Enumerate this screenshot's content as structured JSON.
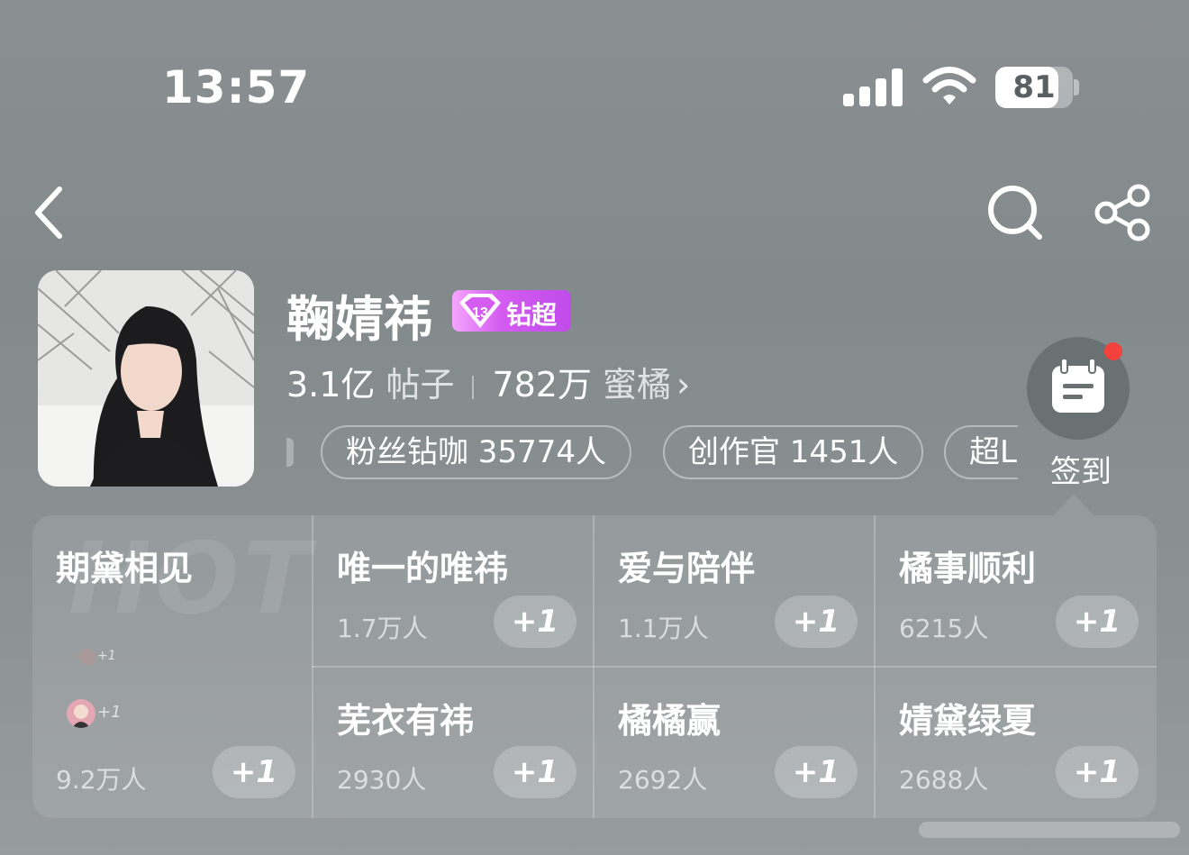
{
  "status_bar": {
    "time": "13:57",
    "battery": "81",
    "battery_level": 0.81
  },
  "header": {
    "title": "鞠婧祎",
    "level_badge": "钻超",
    "posts_value": "3.1亿",
    "posts_unit": "帖子",
    "fans_value": "782万",
    "fans_unit": "蜜橘",
    "chevron": "›",
    "pills": [
      "粉丝钻咖 35774人",
      "创作官 1451人",
      "超L"
    ],
    "checkin_label": "签到"
  },
  "groups": {
    "hot_bg": "HOT",
    "plus_label": "+1",
    "mini_plus": "+1",
    "featured": {
      "name": "期黛相见",
      "count": "9.2万人"
    },
    "items": [
      {
        "name": "唯一的唯祎",
        "count": "1.7万人"
      },
      {
        "name": "爱与陪伴",
        "count": "1.1万人"
      },
      {
        "name": "橘事顺利",
        "count": "6215人"
      },
      {
        "name": "芜衣有祎",
        "count": "2930人"
      },
      {
        "name": "橘橘赢",
        "count": "2692人"
      },
      {
        "name": "婧黛绿夏",
        "count": "2688人"
      }
    ]
  },
  "colors": {
    "badge": "#c04bea",
    "notify_dot": "#f2423b"
  },
  "icons": [
    "back-icon",
    "search-icon",
    "share-icon",
    "calendar-icon",
    "diamond-icon",
    "signal-icon",
    "wifi-icon",
    "battery-icon"
  ]
}
